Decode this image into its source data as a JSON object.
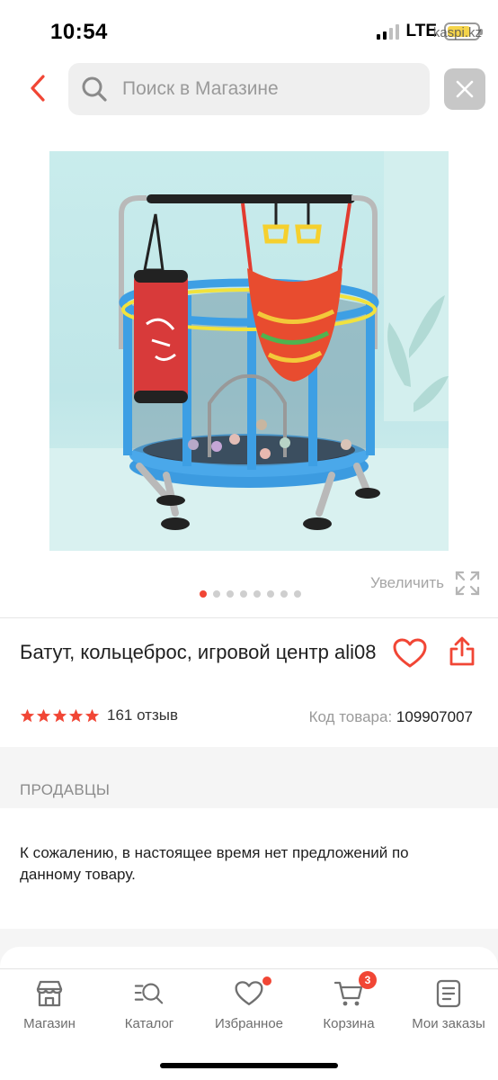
{
  "status_bar": {
    "time": "10:54",
    "network": "LTE",
    "watermark": "kaspi.kz"
  },
  "search": {
    "placeholder": "Поиск в Магазине"
  },
  "gallery": {
    "image_icon": "trampoline-image",
    "current_page": 1,
    "page_count": 8,
    "zoom_label": "Увеличить"
  },
  "product": {
    "title": "Батут, кольцеброс, игровой центр ali08",
    "rating_stars": 5,
    "reviews_label": "161 отзыв",
    "sku_label": "Код товара:",
    "sku_value": "109907007"
  },
  "sellers": {
    "heading": "ПРОДАВЦЫ",
    "empty_message": "К сожалению, в настоящее время нет предложений по данному товару."
  },
  "tabs": [
    {
      "label": "Магазин",
      "icon": "store-icon"
    },
    {
      "label": "Каталог",
      "icon": "catalog-search-icon"
    },
    {
      "label": "Избранное",
      "icon": "heart-icon",
      "dot": true
    },
    {
      "label": "Корзина",
      "icon": "cart-icon",
      "badge": "3"
    },
    {
      "label": "Мои заказы",
      "icon": "orders-icon"
    }
  ],
  "colors": {
    "accent": "#f14635",
    "star": "#f14635",
    "text_secondary": "#9a9a9a",
    "section_bg": "#f5f5f5"
  }
}
